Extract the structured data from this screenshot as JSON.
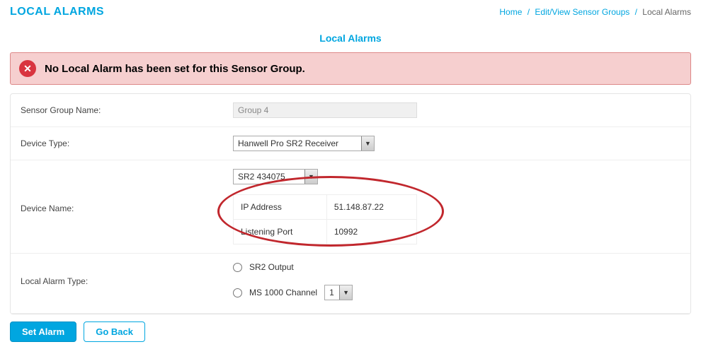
{
  "heading": "LOCAL ALARMS",
  "breadcrumb": {
    "home": "Home",
    "mid": "Edit/View Sensor Groups",
    "current": "Local Alarms"
  },
  "subhead": "Local Alarms",
  "alert": {
    "msg": "No Local Alarm has been set for this Sensor Group."
  },
  "form": {
    "sensor_group_label": "Sensor Group Name:",
    "sensor_group_value": "Group 4",
    "device_type_label": "Device Type:",
    "device_type_value": "Hanwell Pro SR2 Receiver",
    "device_name_label": "Device Name:",
    "device_name_value": "SR2 434075",
    "ip_label": "IP Address",
    "ip_value": "51.148.87.22",
    "port_label": "Listening Port",
    "port_value": "10992",
    "alarm_type_label": "Local Alarm Type:",
    "radio1_label": "SR2 Output",
    "radio2_label": "MS 1000 Channel",
    "channel_value": "1"
  },
  "buttons": {
    "set": "Set Alarm",
    "back": "Go Back"
  }
}
